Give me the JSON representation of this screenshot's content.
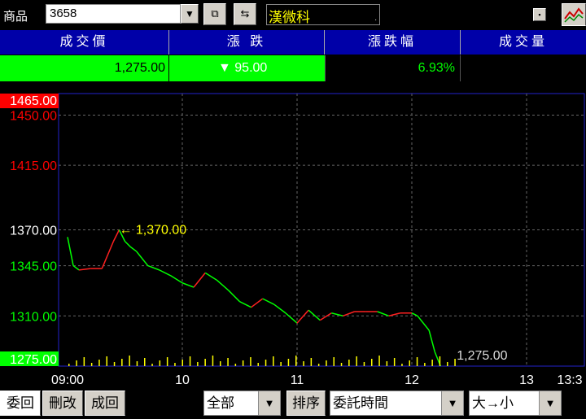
{
  "toolbar": {
    "product_label": "商品",
    "product_code": "3658",
    "dropdown_arrow": "▼",
    "stock_name": "漢微科",
    "name_box_dot": "."
  },
  "quote": {
    "headers": [
      "成交價",
      "漲 跌",
      "漲跌幅",
      "成交量"
    ],
    "price": "1,275.00",
    "change": "▼ 95.00",
    "change_pct": "6.93%",
    "volume": "",
    "colors": {
      "header_bg": "#0000a8",
      "down": "#00ff00",
      "up": "#ff0000",
      "annotation": "#ffff00"
    }
  },
  "chart_data": {
    "type": "line",
    "y_ticks": [
      "1465.00",
      "1450.00",
      "1415.00",
      "1370.00",
      "1345.00",
      "1310.00",
      "1275.00"
    ],
    "y_tick_values": [
      1465,
      1450,
      1415,
      1370,
      1345,
      1310,
      1275
    ],
    "x_ticks": [
      "09:00",
      "10",
      "11",
      "12",
      "13",
      "13:3"
    ],
    "ylim": [
      1275,
      1465
    ],
    "high_label": "← 1,370.00",
    "last_label": "1,275.00",
    "grid": true,
    "x": [
      0,
      0.05,
      0.1,
      0.2,
      0.3,
      0.4,
      0.45,
      0.5,
      0.55,
      0.6,
      0.65,
      0.7,
      0.8,
      0.9,
      1.0,
      1.1,
      1.2,
      1.3,
      1.4,
      1.5,
      1.6,
      1.7,
      1.8,
      1.9,
      2.0,
      2.1,
      2.2,
      2.3,
      2.4,
      2.5,
      2.6,
      2.7,
      2.8,
      2.9,
      3.0,
      3.05,
      3.1,
      3.15,
      3.2,
      3.25
    ],
    "y": [
      1365,
      1345,
      1342,
      1343,
      1343,
      1362,
      1370,
      1362,
      1358,
      1355,
      1350,
      1345,
      1342,
      1338,
      1333,
      1330,
      1340,
      1335,
      1328,
      1320,
      1316,
      1322,
      1318,
      1312,
      1305,
      1314,
      1307,
      1312,
      1310,
      1313,
      1313,
      1313,
      1310,
      1312,
      1312,
      1310,
      1305,
      1300,
      1285,
      1275
    ]
  },
  "bottom": {
    "tabs": [
      "委回",
      "刪改",
      "成回"
    ],
    "filter_value": "全部",
    "sort_label": "排序",
    "sort_field": "委託時間",
    "sort_order": "大→小"
  }
}
